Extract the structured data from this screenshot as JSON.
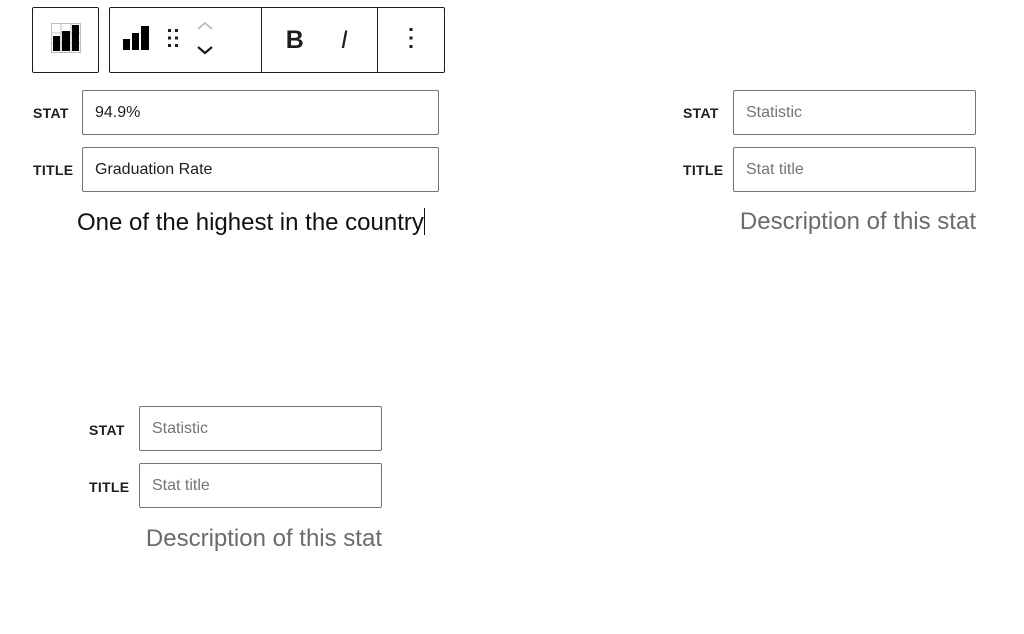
{
  "toolbar": {
    "block_switcher_icon": "stats-grid-chart-icon",
    "block_type_icon": "bar-chart-icon",
    "drag_handle_icon": "drag-handle-icon",
    "move_up_icon": "chevron-up-icon",
    "move_down_icon": "chevron-down-icon",
    "bold_label": "B",
    "italic_label": "I",
    "more_options_icon": "more-vertical-icon"
  },
  "stats": [
    {
      "stat_label": "STAT",
      "stat_value": "94.9%",
      "stat_placeholder": "Statistic",
      "title_label": "TITLE",
      "title_value": "Graduation Rate",
      "title_placeholder": "Stat title",
      "description": "One of the highest in the country",
      "description_placeholder": "Description of this stat"
    },
    {
      "stat_label": "STAT",
      "stat_value": "",
      "stat_placeholder": "Statistic",
      "title_label": "TITLE",
      "title_value": "",
      "title_placeholder": "Stat title",
      "description": "",
      "description_placeholder": "Description of this stat"
    },
    {
      "stat_label": "STAT",
      "stat_value": "",
      "stat_placeholder": "Statistic",
      "title_label": "TITLE",
      "title_value": "",
      "title_placeholder": "Stat title",
      "description": "",
      "description_placeholder": "Description of this stat"
    }
  ],
  "colors": {
    "border_dark": "#1e1e1e",
    "input_border": "#757575",
    "placeholder": "#757575"
  }
}
